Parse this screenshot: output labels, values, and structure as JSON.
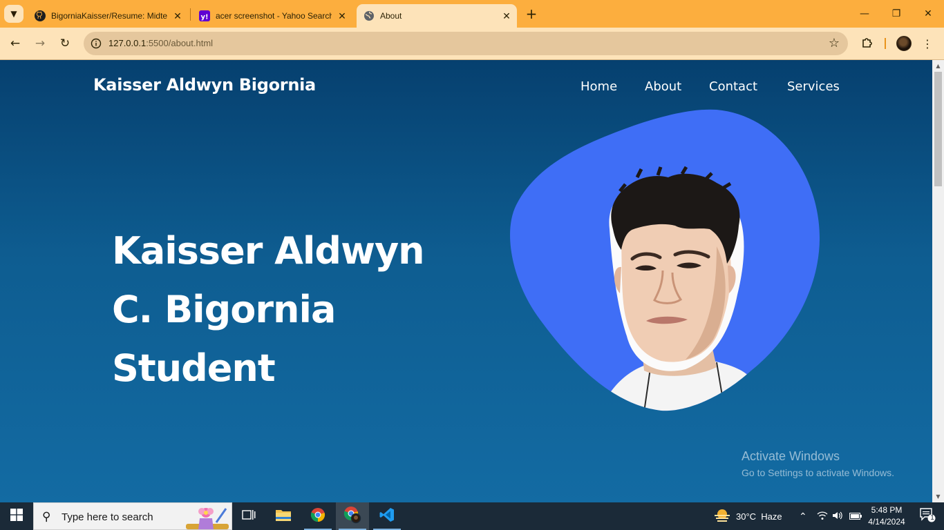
{
  "browser": {
    "tabs": [
      {
        "title": "BigorniaKaisser/Resume: Midte",
        "icon": "github-icon"
      },
      {
        "title": "acer screenshot - Yahoo Search",
        "icon": "yahoo-icon"
      },
      {
        "title": "About",
        "icon": "globe-icon",
        "active": true
      }
    ],
    "new_tab_icon": "plus-icon",
    "url_host": "127.0.0.1",
    "url_path": ":5500/about.html"
  },
  "site": {
    "brand": "Kaisser Aldwyn Bigornia",
    "nav": [
      "Home",
      "About",
      "Contact",
      "Services"
    ],
    "hero_lines": [
      "Kaisser Aldwyn",
      "C. Bigornia",
      "Student"
    ],
    "accent_color": "#3f6ef6",
    "background_top": "#06406f",
    "background_bottom": "#136ba3"
  },
  "watermark": {
    "title": "Activate Windows",
    "subtitle": "Go to Settings to activate Windows."
  },
  "taskbar": {
    "search_placeholder": "Type here to search",
    "weather": "30°C  Haze",
    "time": "5:48 PM",
    "date": "4/14/2024",
    "notification_count": "1"
  }
}
